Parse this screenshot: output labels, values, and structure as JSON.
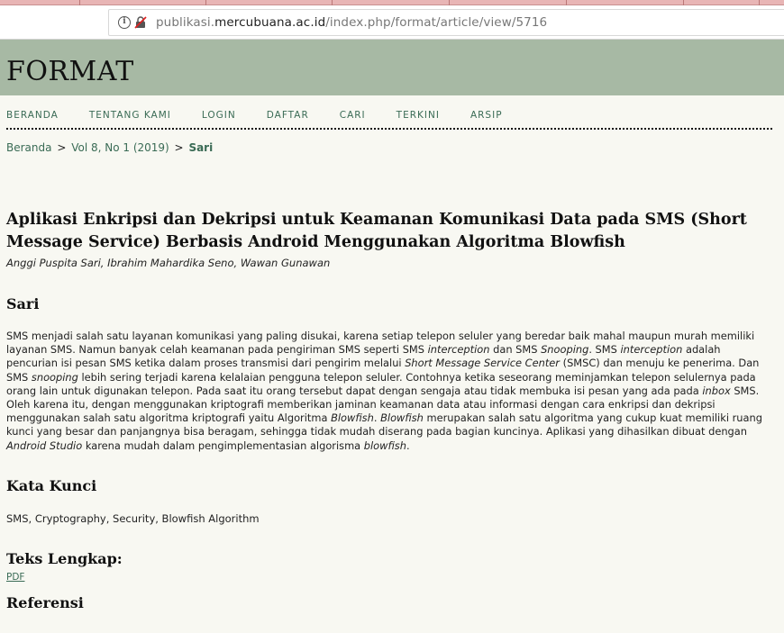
{
  "browser": {
    "url_prefix": "publikasi.",
    "url_domain": "mercubuana.ac.id",
    "url_path": "/index.php/format/article/view/5716"
  },
  "site": {
    "title": "FORMAT"
  },
  "nav": {
    "items": [
      "BERANDA",
      "TENTANG KAMI",
      "LOGIN",
      "DAFTAR",
      "CARI",
      "TERKINI",
      "ARSIP"
    ]
  },
  "breadcrumb": {
    "home": "Beranda",
    "sep": ">",
    "issue": "Vol 8, No 1 (2019)",
    "current": "Sari"
  },
  "article": {
    "title": "Aplikasi Enkripsi dan Dekripsi untuk Keamanan Komunikasi Data pada SMS (Short Message Service) Berbasis Android Menggunakan Algoritma Blowfish",
    "authors": "Anggi Puspita Sari, Ibrahim Mahardika Seno, Wawan Gunawan",
    "abstract_heading": "Sari",
    "abstract_parts": [
      "SMS menjadi salah satu layanan komunikasi yang paling disukai, karena setiap telepon seluler yang beredar baik mahal maupun murah memiliki layanan SMS. Namun banyak celah keamanan pada pengiriman SMS seperti SMS ",
      "interception",
      " dan SMS ",
      "Snooping",
      ". SMS ",
      "interception",
      " adalah pencurian isi pesan SMS ketika dalam proses transmisi dari pengirim melalui ",
      "Short Message Service Center",
      " (SMSC) dan menuju ke  penerima. Dan SMS ",
      "snooping",
      " lebih sering terjadi karena kelalaian pengguna telepon seluler. Contohnya ketika seseorang meminjamkan telepon selulernya pada orang lain untuk digunakan telepon. Pada saat itu orang tersebut dapat dengan sengaja atau tidak membuka isi pesan yang ada pada ",
      "inbox",
      " SMS. Oleh karena itu, dengan menggunakan kriptografi memberikan jaminan keamanan data atau informasi dengan cara enkripsi dan dekripsi menggunakan salah satu algoritma kriptografi yaitu Algoritma ",
      "Blowfish",
      ". ",
      "Blowfish",
      " merupakan salah satu algoritma yang cukup kuat memiliki ruang kunci yang besar dan panjangnya bisa beragam, sehingga tidak mudah diserang pada bagian kuncinya. Aplikasi yang dihasilkan dibuat dengan ",
      "Android Studio",
      " karena mudah dalam pengimplementasian algorisma ",
      "blowfish",
      "."
    ],
    "keywords_heading": "Kata Kunci",
    "keywords": "SMS, Cryptography, Security, Blowfish Algorithm",
    "fulltext_heading": "Teks Lengkap:",
    "pdf_label": "PDF",
    "references_heading": "Referensi"
  }
}
